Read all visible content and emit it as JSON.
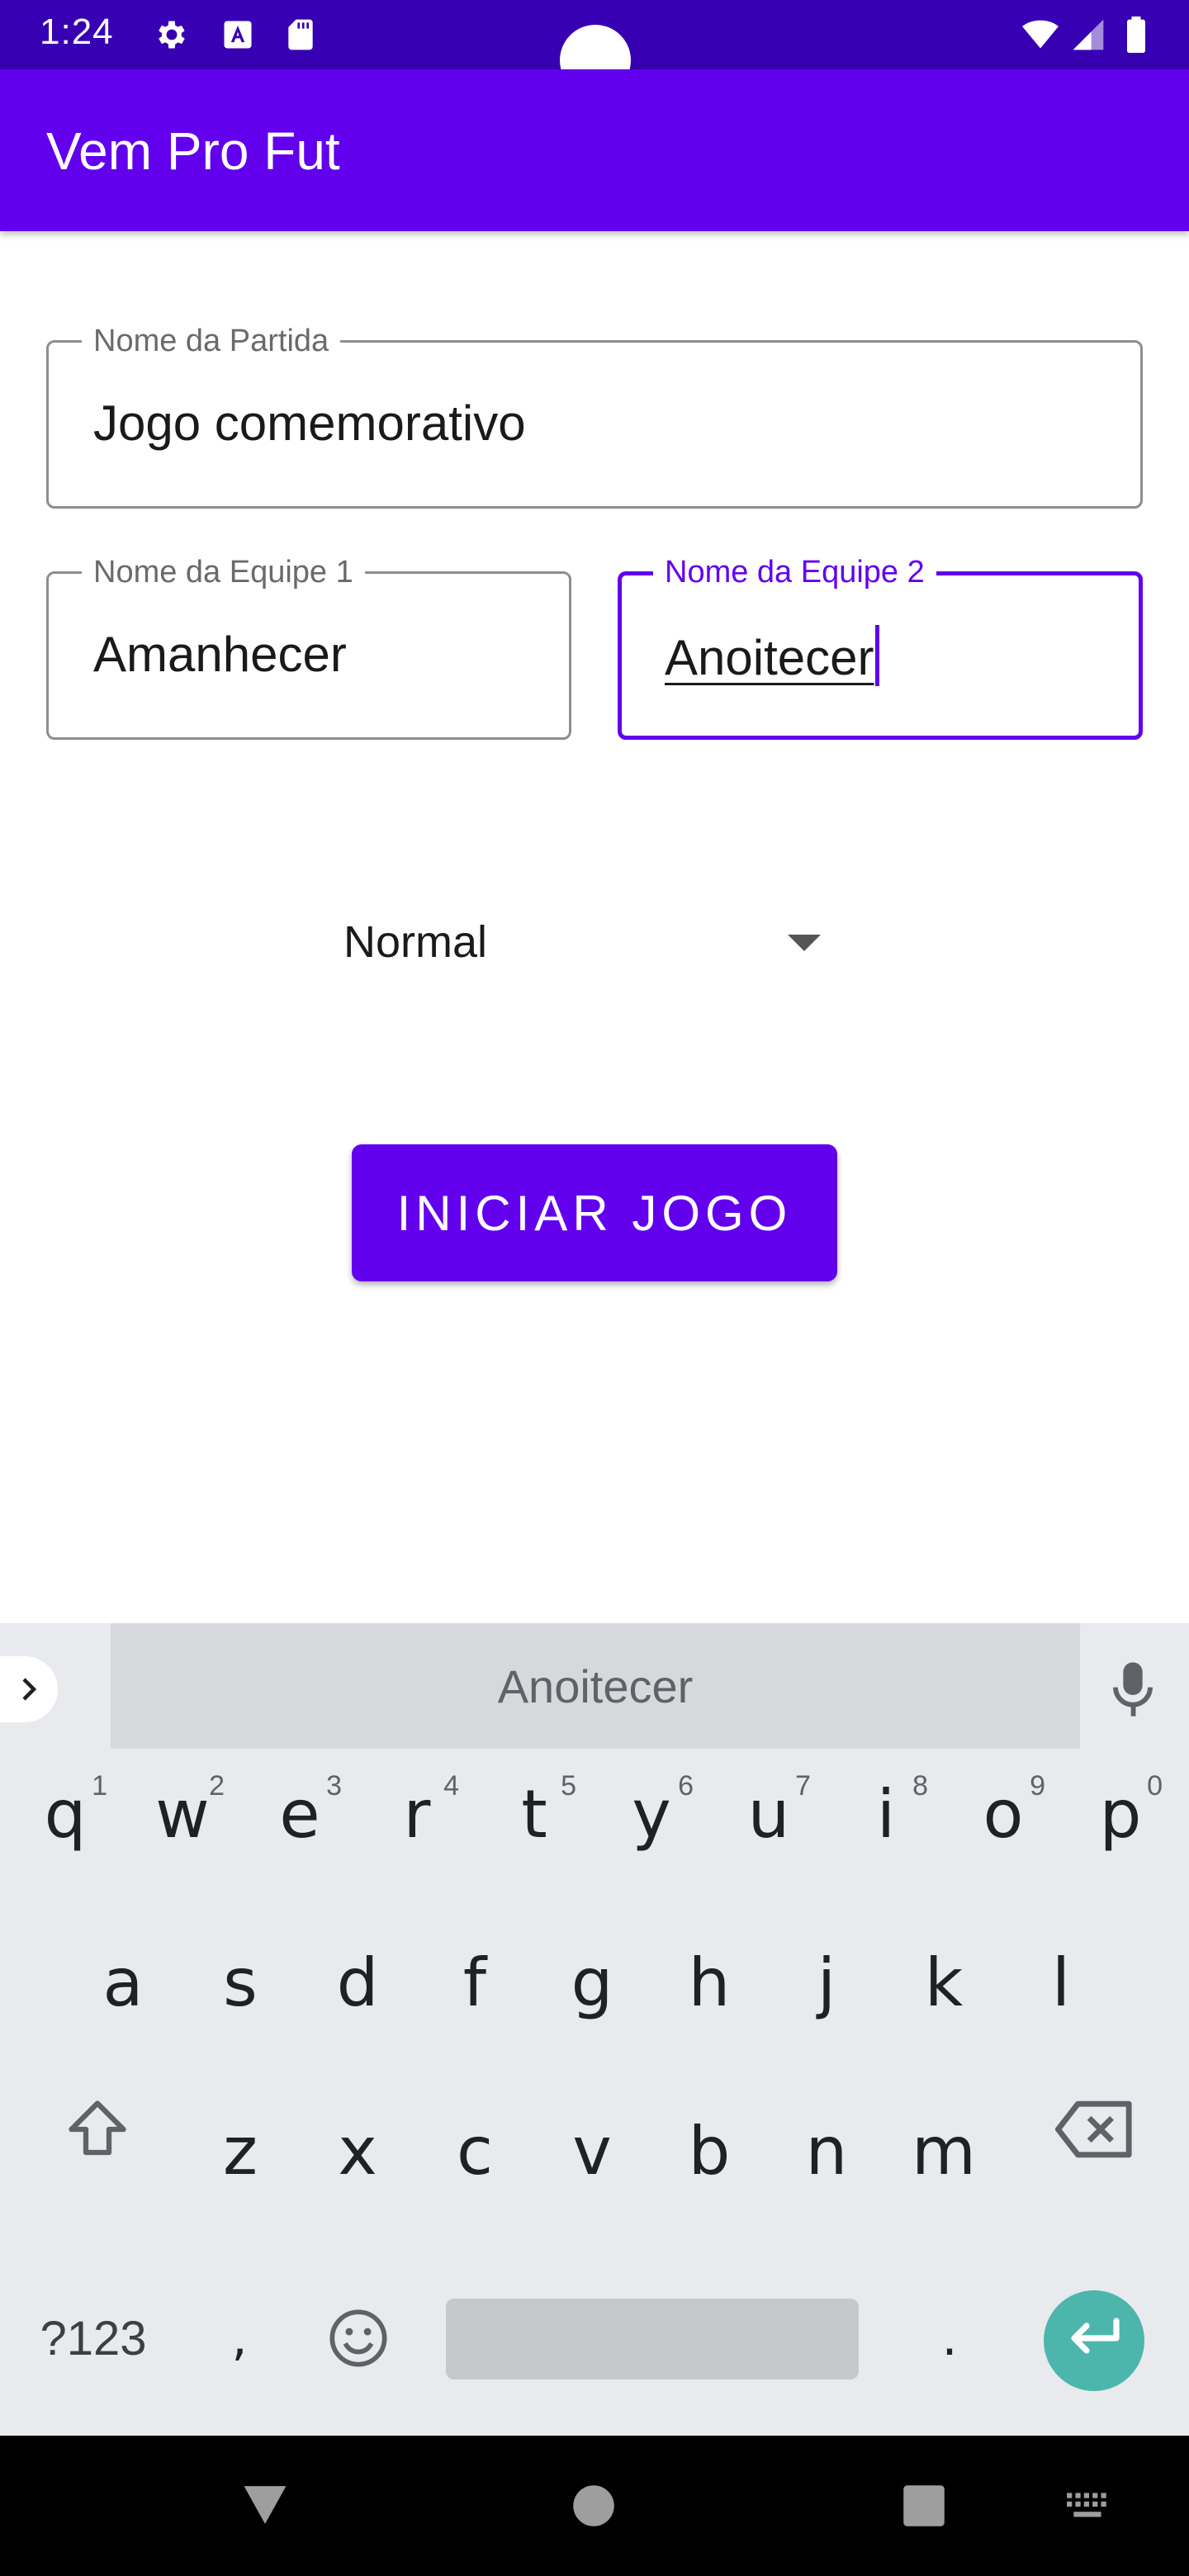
{
  "status_bar": {
    "time": "1:24",
    "left_icons": [
      "gear-icon",
      "font-a-icon",
      "sd-card-icon"
    ],
    "right_icons": [
      "wifi-icon",
      "signal-icon",
      "battery-icon"
    ]
  },
  "app_bar": {
    "title": "Vem Pro Fut"
  },
  "form": {
    "match_name": {
      "label": "Nome da Partida",
      "value": "Jogo comemorativo"
    },
    "team1": {
      "label": "Nome da Equipe 1",
      "value": "Amanhecer"
    },
    "team2": {
      "label": "Nome da Equipe 2",
      "value": "Anoitecer"
    },
    "mode_select": {
      "value": "Normal"
    },
    "start_button": {
      "label": "INICIAR JOGO"
    }
  },
  "colors": {
    "primary": "#6200ee",
    "primary_dark": "#3700b3",
    "enter_key": "#4db6ac"
  },
  "keyboard": {
    "suggestion": "Anoitecer",
    "row1": [
      {
        "key": "q",
        "hint": "1"
      },
      {
        "key": "w",
        "hint": "2"
      },
      {
        "key": "e",
        "hint": "3"
      },
      {
        "key": "r",
        "hint": "4"
      },
      {
        "key": "t",
        "hint": "5"
      },
      {
        "key": "y",
        "hint": "6"
      },
      {
        "key": "u",
        "hint": "7"
      },
      {
        "key": "i",
        "hint": "8"
      },
      {
        "key": "o",
        "hint": "9"
      },
      {
        "key": "p",
        "hint": "0"
      }
    ],
    "row2": [
      "a",
      "s",
      "d",
      "f",
      "g",
      "h",
      "j",
      "k",
      "l"
    ],
    "row3": [
      "z",
      "x",
      "c",
      "v",
      "b",
      "n",
      "m"
    ],
    "symbols_key": "?123",
    "comma_key": ",",
    "period_key": "."
  }
}
